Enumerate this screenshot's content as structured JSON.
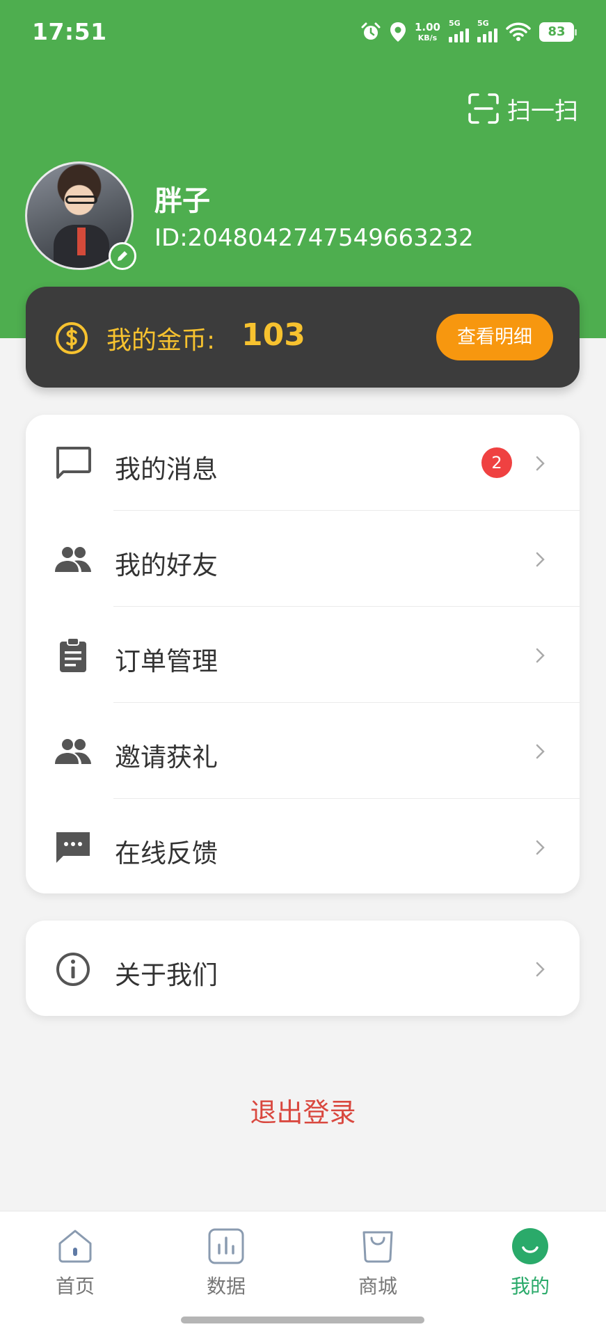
{
  "status_bar": {
    "time": "17:51",
    "net_speed_value": "1.00",
    "net_speed_unit": "KB/s",
    "sim1": "5G",
    "sim2": "5G",
    "battery": "83"
  },
  "header": {
    "scan_label": "扫一扫",
    "username": "胖子",
    "user_id": "ID:2048042747549663232"
  },
  "coins": {
    "label": "我的金币:",
    "value": "103",
    "detail_button": "查看明细"
  },
  "menu": {
    "items": [
      {
        "label": "我的消息",
        "icon": "message-icon",
        "badge": "2"
      },
      {
        "label": "我的好友",
        "icon": "friends-icon"
      },
      {
        "label": "订单管理",
        "icon": "clipboard-icon"
      },
      {
        "label": "邀请获礼",
        "icon": "invite-icon"
      },
      {
        "label": "在线反馈",
        "icon": "feedback-icon"
      }
    ],
    "about": {
      "label": "关于我们",
      "icon": "info-icon"
    }
  },
  "logout_label": "退出登录",
  "tabbar": {
    "tabs": [
      {
        "label": "首页",
        "icon": "home-icon"
      },
      {
        "label": "数据",
        "icon": "chart-icon"
      },
      {
        "label": "商城",
        "icon": "shop-bag-icon"
      },
      {
        "label": "我的",
        "icon": "profile-icon",
        "active": true
      }
    ]
  },
  "colors": {
    "brand_green": "#4eae4f",
    "coin_gold": "#f7c22f",
    "button_orange": "#f7970f",
    "logout_red": "#d9483f",
    "tab_active": "#2aaa6a"
  }
}
